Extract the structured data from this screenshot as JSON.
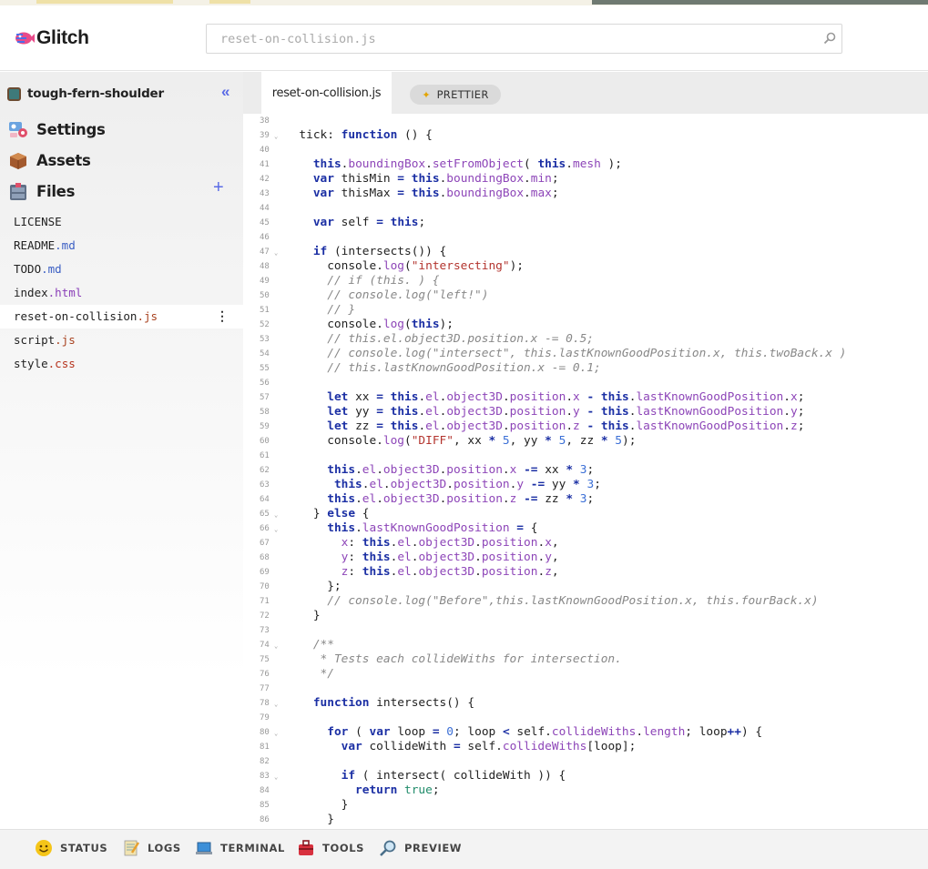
{
  "app": {
    "logo_text": "Glitch",
    "search_placeholder": "reset-on-collision.js"
  },
  "sidebar": {
    "project_name": "tough-fern-shoulder",
    "nav": [
      {
        "label": "Settings",
        "icon": "settings-icon"
      },
      {
        "label": "Assets",
        "icon": "assets-box-icon"
      },
      {
        "label": "Files",
        "icon": "files-cabinet-icon"
      }
    ],
    "files": [
      {
        "base": "LICENSE",
        "ext": ""
      },
      {
        "base": "README",
        "ext": ".md"
      },
      {
        "base": "TODO",
        "ext": ".md"
      },
      {
        "base": "index",
        "ext": ".html"
      },
      {
        "base": "reset-on-collision",
        "ext": ".js"
      },
      {
        "base": "script",
        "ext": ".js"
      },
      {
        "base": "style",
        "ext": ".css"
      }
    ],
    "active_file_kebab": "⋮",
    "collapse_glyph": "«",
    "add_glyph": "+"
  },
  "tabs": {
    "active_tab": "reset-on-collision.js",
    "prettier_label": "PRETTIER"
  },
  "editor": {
    "lines": [
      {
        "n": "38",
        "fold": false,
        "html": ""
      },
      {
        "n": "39",
        "fold": true,
        "html": "  tick: <span class=\"k\">function</span> () {"
      },
      {
        "n": "40",
        "fold": false,
        "html": ""
      },
      {
        "n": "41",
        "fold": false,
        "html": "    <span class=\"k\">this</span>.<span class=\"p\">boundingBox</span>.<span class=\"p\">setFromObject</span>( <span class=\"k\">this</span>.<span class=\"p\">mesh</span> );"
      },
      {
        "n": "42",
        "fold": false,
        "html": "    <span class=\"k\">var</span> thisMin <span class=\"k\">=</span> <span class=\"k\">this</span>.<span class=\"p\">boundingBox</span>.<span class=\"p\">min</span>;"
      },
      {
        "n": "43",
        "fold": false,
        "html": "    <span class=\"k\">var</span> thisMax <span class=\"k\">=</span> <span class=\"k\">this</span>.<span class=\"p\">boundingBox</span>.<span class=\"p\">max</span>;"
      },
      {
        "n": "44",
        "fold": false,
        "html": ""
      },
      {
        "n": "45",
        "fold": false,
        "html": "    <span class=\"k\">var</span> self <span class=\"k\">=</span> <span class=\"k\">this</span>;"
      },
      {
        "n": "46",
        "fold": false,
        "html": ""
      },
      {
        "n": "47",
        "fold": true,
        "html": "    <span class=\"k\">if</span> (intersects()) {"
      },
      {
        "n": "48",
        "fold": false,
        "html": "      console.<span class=\"p\">log</span>(<span class=\"s\">\"intersecting\"</span>);"
      },
      {
        "n": "49",
        "fold": false,
        "html": "      <span class=\"c\">// if (this. ) {</span>"
      },
      {
        "n": "50",
        "fold": false,
        "html": "      <span class=\"c\">// console.log(\"left!\")</span>"
      },
      {
        "n": "51",
        "fold": false,
        "html": "      <span class=\"c\">// }</span>"
      },
      {
        "n": "52",
        "fold": false,
        "html": "      console.<span class=\"p\">log</span>(<span class=\"k\">this</span>);"
      },
      {
        "n": "53",
        "fold": false,
        "html": "      <span class=\"c\">// this.el.object3D.position.x -= 0.5;</span>"
      },
      {
        "n": "54",
        "fold": false,
        "html": "      <span class=\"c\">// console.log(\"intersect\", this.lastKnownGoodPosition.x, this.twoBack.x )</span>"
      },
      {
        "n": "55",
        "fold": false,
        "html": "      <span class=\"c\">// this.lastKnownGoodPosition.x -= 0.1;</span>"
      },
      {
        "n": "56",
        "fold": false,
        "html": ""
      },
      {
        "n": "57",
        "fold": false,
        "html": "      <span class=\"k\">let</span> xx <span class=\"k\">=</span> <span class=\"k\">this</span>.<span class=\"p\">el</span>.<span class=\"p\">object3D</span>.<span class=\"p\">position</span>.<span class=\"p\">x</span> <span class=\"k\">-</span> <span class=\"k\">this</span>.<span class=\"p\">lastKnownGoodPosition</span>.<span class=\"p\">x</span>;"
      },
      {
        "n": "58",
        "fold": false,
        "html": "      <span class=\"k\">let</span> yy <span class=\"k\">=</span> <span class=\"k\">this</span>.<span class=\"p\">el</span>.<span class=\"p\">object3D</span>.<span class=\"p\">position</span>.<span class=\"p\">y</span> <span class=\"k\">-</span> <span class=\"k\">this</span>.<span class=\"p\">lastKnownGoodPosition</span>.<span class=\"p\">y</span>;"
      },
      {
        "n": "59",
        "fold": false,
        "html": "      <span class=\"k\">let</span> zz <span class=\"k\">=</span> <span class=\"k\">this</span>.<span class=\"p\">el</span>.<span class=\"p\">object3D</span>.<span class=\"p\">position</span>.<span class=\"p\">z</span> <span class=\"k\">-</span> <span class=\"k\">this</span>.<span class=\"p\">lastKnownGoodPosition</span>.<span class=\"p\">z</span>;"
      },
      {
        "n": "60",
        "fold": false,
        "html": "      console.<span class=\"p\">log</span>(<span class=\"s\">\"DIFF\"</span>, xx <span class=\"k\">*</span> <span class=\"n\">5</span>, yy <span class=\"k\">*</span> <span class=\"n\">5</span>, zz <span class=\"k\">*</span> <span class=\"n\">5</span>);"
      },
      {
        "n": "61",
        "fold": false,
        "html": ""
      },
      {
        "n": "62",
        "fold": false,
        "html": "      <span class=\"k\">this</span>.<span class=\"p\">el</span>.<span class=\"p\">object3D</span>.<span class=\"p\">position</span>.<span class=\"p\">x</span> <span class=\"k\">-=</span> xx <span class=\"k\">*</span> <span class=\"n\">3</span>;"
      },
      {
        "n": "63",
        "fold": false,
        "html": "       <span class=\"k\">this</span>.<span class=\"p\">el</span>.<span class=\"p\">object3D</span>.<span class=\"p\">position</span>.<span class=\"p\">y</span> <span class=\"k\">-=</span> yy <span class=\"k\">*</span> <span class=\"n\">3</span>;"
      },
      {
        "n": "64",
        "fold": false,
        "html": "      <span class=\"k\">this</span>.<span class=\"p\">el</span>.<span class=\"p\">object3D</span>.<span class=\"p\">position</span>.<span class=\"p\">z</span> <span class=\"k\">-=</span> zz <span class=\"k\">*</span> <span class=\"n\">3</span>;"
      },
      {
        "n": "65",
        "fold": true,
        "html": "    } <span class=\"k\">else</span> {"
      },
      {
        "n": "66",
        "fold": true,
        "html": "      <span class=\"k\">this</span>.<span class=\"p\">lastKnownGoodPosition</span> <span class=\"k\">=</span> {"
      },
      {
        "n": "67",
        "fold": false,
        "html": "        <span class=\"p\">x</span>: <span class=\"k\">this</span>.<span class=\"p\">el</span>.<span class=\"p\">object3D</span>.<span class=\"p\">position</span>.<span class=\"p\">x</span>,"
      },
      {
        "n": "68",
        "fold": false,
        "html": "        <span class=\"p\">y</span>: <span class=\"k\">this</span>.<span class=\"p\">el</span>.<span class=\"p\">object3D</span>.<span class=\"p\">position</span>.<span class=\"p\">y</span>,"
      },
      {
        "n": "69",
        "fold": false,
        "html": "        <span class=\"p\">z</span>: <span class=\"k\">this</span>.<span class=\"p\">el</span>.<span class=\"p\">object3D</span>.<span class=\"p\">position</span>.<span class=\"p\">z</span>,"
      },
      {
        "n": "70",
        "fold": false,
        "html": "      };"
      },
      {
        "n": "71",
        "fold": false,
        "html": "      <span class=\"c\">// console.log(\"Before\",this.lastKnownGoodPosition.x, this.fourBack.x)</span>"
      },
      {
        "n": "72",
        "fold": false,
        "html": "    }"
      },
      {
        "n": "73",
        "fold": false,
        "html": ""
      },
      {
        "n": "74",
        "fold": true,
        "html": "    <span class=\"c\">/**</span>"
      },
      {
        "n": "75",
        "fold": false,
        "html": "    <span class=\"c\"> * Tests each collideWiths for intersection.</span>"
      },
      {
        "n": "76",
        "fold": false,
        "html": "    <span class=\"c\"> */</span>"
      },
      {
        "n": "77",
        "fold": false,
        "html": ""
      },
      {
        "n": "78",
        "fold": true,
        "html": "    <span class=\"k\">function</span> intersects() {"
      },
      {
        "n": "79",
        "fold": false,
        "html": ""
      },
      {
        "n": "80",
        "fold": true,
        "html": "      <span class=\"k\">for</span> ( <span class=\"k\">var</span> loop <span class=\"k\">=</span> <span class=\"n\">0</span>; loop <span class=\"k\">&lt;</span> self.<span class=\"p\">collideWiths</span>.<span class=\"p\">length</span>; loop<span class=\"k\">++</span>) {"
      },
      {
        "n": "81",
        "fold": false,
        "html": "        <span class=\"k\">var</span> collideWith <span class=\"k\">=</span> self.<span class=\"p\">collideWiths</span>[loop];"
      },
      {
        "n": "82",
        "fold": false,
        "html": ""
      },
      {
        "n": "83",
        "fold": true,
        "html": "        <span class=\"k\">if</span> ( intersect( collideWith )) {"
      },
      {
        "n": "84",
        "fold": false,
        "html": "          <span class=\"k\">return</span> <span class=\"b\">true</span>;"
      },
      {
        "n": "85",
        "fold": false,
        "html": "        }"
      },
      {
        "n": "86",
        "fold": false,
        "html": "      }"
      }
    ]
  },
  "bottom": {
    "items": [
      {
        "label": "STATUS",
        "icon": "smiley-status-icon"
      },
      {
        "label": "LOGS",
        "icon": "notepad-logs-icon"
      },
      {
        "label": "TERMINAL",
        "icon": "laptop-terminal-icon"
      },
      {
        "label": "TOOLS",
        "icon": "toolbox-icon"
      },
      {
        "label": "PREVIEW",
        "icon": "magnifier-preview-icon"
      }
    ]
  },
  "colors": {
    "accent": "#5a6be6",
    "keyword": "#1b2fa4",
    "property": "#8d45b8",
    "string": "#b3342e",
    "comment": "#888888"
  }
}
